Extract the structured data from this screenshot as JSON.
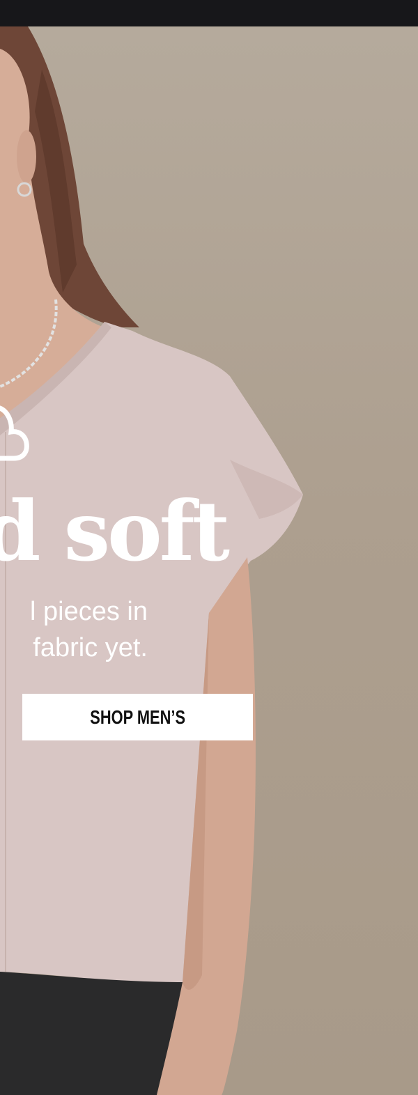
{
  "hero": {
    "headline": "d soft",
    "body_lines": [
      "l pieces in",
      "fabric yet."
    ],
    "cta_label": "SHOP MEN’S"
  },
  "icons": {
    "cloud": "cloud-icon"
  },
  "colors": {
    "top_bar": "#17171a",
    "backdrop": "#b2a697",
    "tee": "#d8c6c4",
    "text": "#ffffff",
    "cta_bg": "#ffffff",
    "cta_text": "#111111"
  }
}
